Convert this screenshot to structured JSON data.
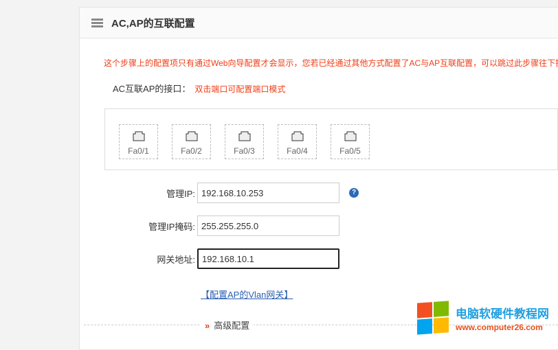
{
  "header": {
    "title": "AC,AP的互联配置"
  },
  "notice": "这个步骤上的配置项只有通过Web向导配置才会显示，您若已经通过其他方式配置了AC与AP互联配置，可以跳过此步骤往下操作",
  "interface": {
    "label": "AC互联AP的接口：",
    "hint": "双击端口可配置端口模式"
  },
  "ports": [
    "Fa0/1",
    "Fa0/2",
    "Fa0/3",
    "Fa0/4",
    "Fa0/5"
  ],
  "form": {
    "mgmt_ip": {
      "label": "管理IP:",
      "value": "192.168.10.253"
    },
    "mask": {
      "label": "管理IP掩码:",
      "value": "255.255.255.0"
    },
    "gateway": {
      "label": "网关地址:",
      "value": "192.168.10.1"
    },
    "help": "?"
  },
  "vlan_link": "【配置AP的Vlan网关】",
  "advanced": {
    "arrow": "»",
    "label": "高级配置"
  },
  "watermark": {
    "name": "电脑软硬件教程网",
    "url": "www.computer26.com"
  }
}
